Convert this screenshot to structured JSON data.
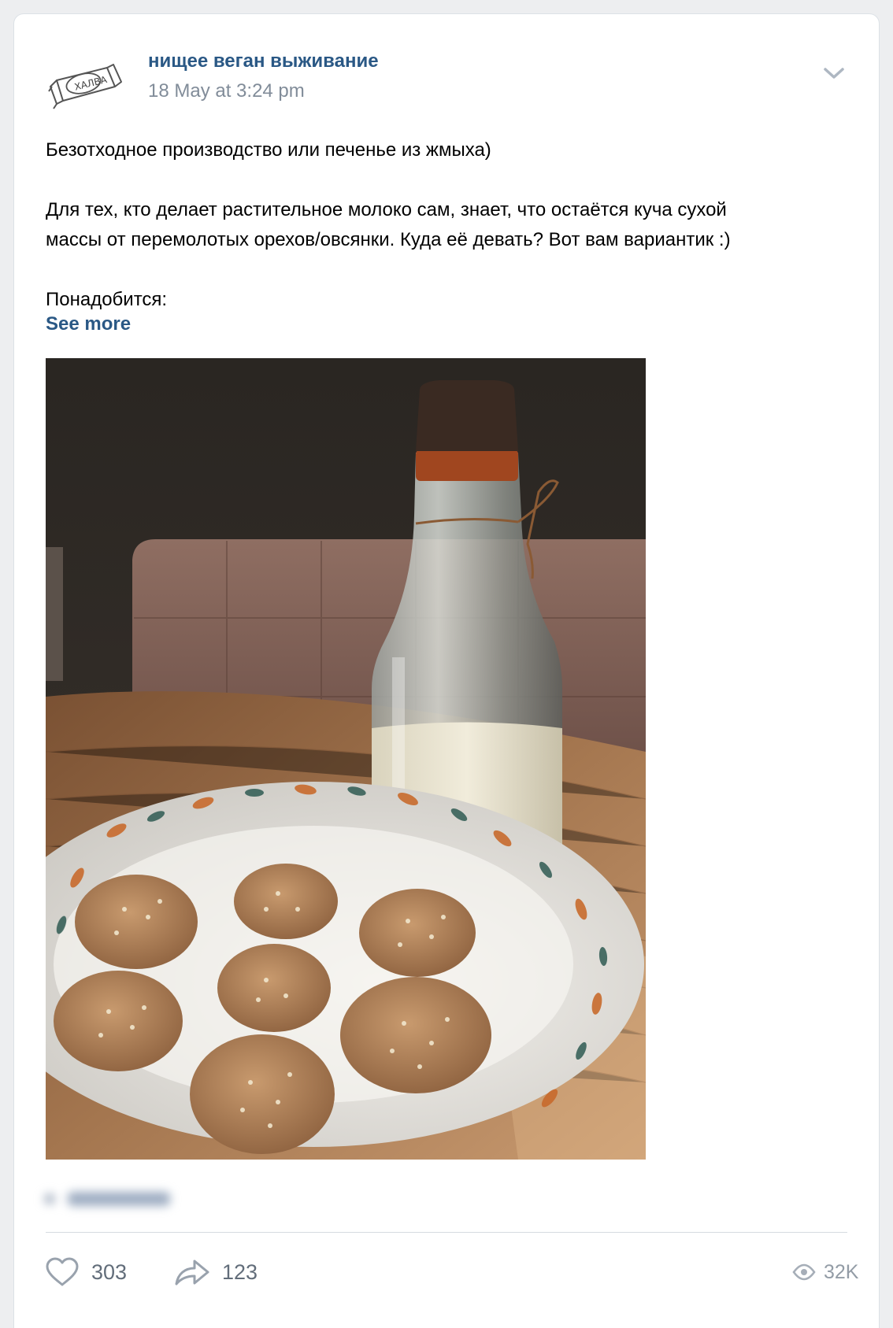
{
  "post": {
    "author": "нищее веган выживание",
    "date": "18 May at 3:24 pm",
    "avatar_label": "ХАЛВА",
    "text": {
      "line1": "Безотходное производство или печенье из жмыха)",
      "line2": "Для тех, кто делает растительное молоко сам, знает, что остаётся куча сухой",
      "line3": "массы от перемолотых орехов/овсянки. Куда её девать? Вот вам вариантик :)",
      "line4": "Понадобится:"
    },
    "see_more": "See more",
    "photo_icon": "cookies-and-milk-bottle-photo"
  },
  "actions": {
    "likes": "303",
    "shares": "123",
    "views": "32K"
  },
  "colors": {
    "link": "#2a5885",
    "meta": "#818c99",
    "background": "#edeef0"
  }
}
